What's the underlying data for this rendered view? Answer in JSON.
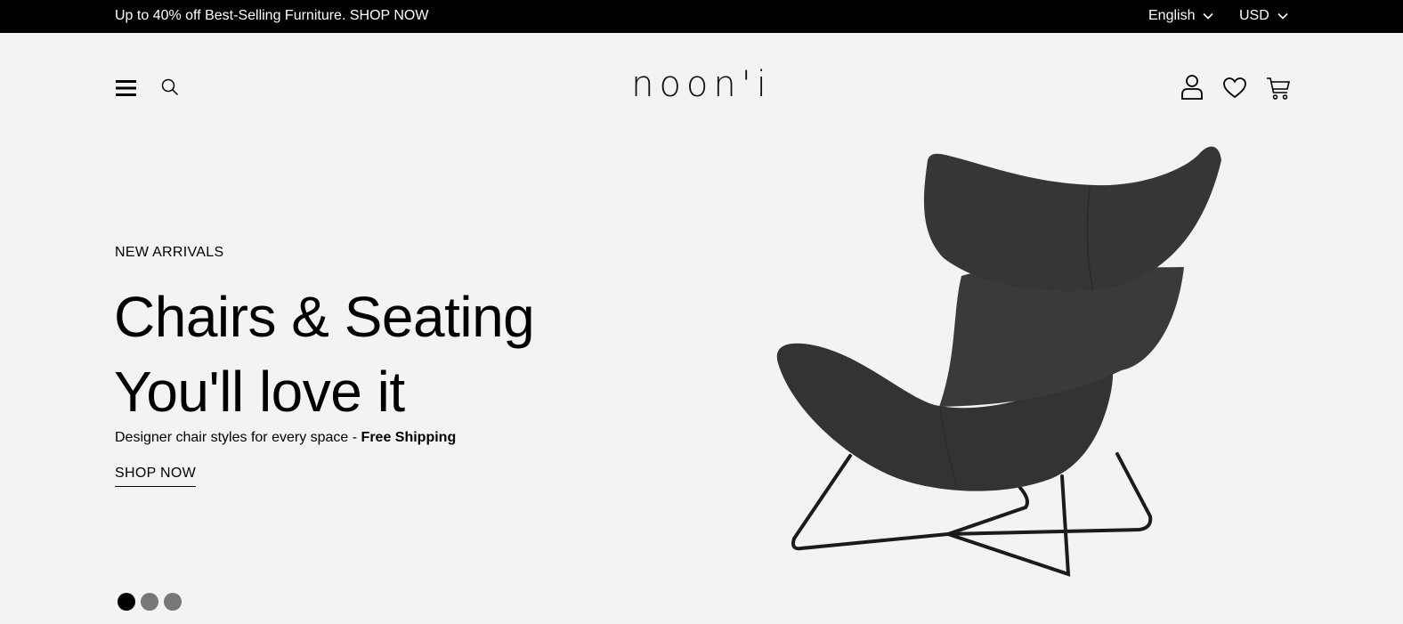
{
  "topbar": {
    "promo": "Up to 40% off Best-Selling Furniture. SHOP NOW",
    "language": "English",
    "currency": "USD",
    "background": "#000000"
  },
  "header": {
    "logo": "noon'i",
    "icons": [
      "menu-icon",
      "search-icon",
      "account-icon",
      "heart-icon",
      "cart-icon"
    ]
  },
  "hero": {
    "eyebrow": "NEW ARRIVALS",
    "headline_line1": "Chairs & Seating",
    "headline_line2": "You'll love it",
    "subtitle": "Designer chair styles for every space - ",
    "subtitle_bold": "Free Shipping",
    "cta": "SHOP NOW",
    "slides": 3,
    "active_slide": 1
  },
  "colors": {
    "background": "#f3f3f3",
    "text": "#000000",
    "dot_inactive": "#777777",
    "chair": "#333333"
  }
}
